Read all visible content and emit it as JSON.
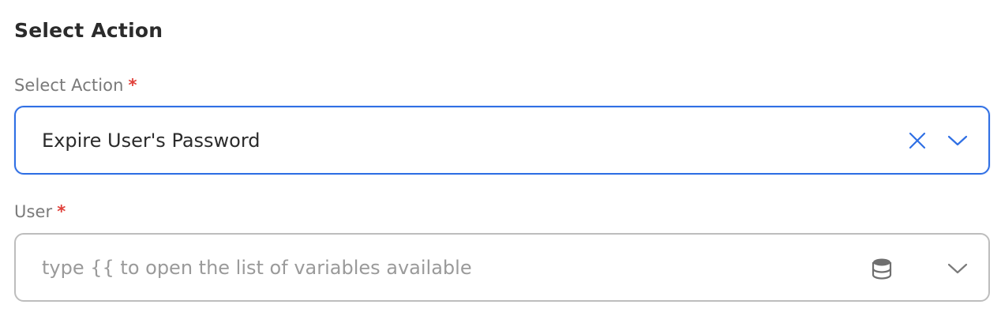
{
  "section": {
    "title": "Select Action"
  },
  "action_field": {
    "label": "Select Action",
    "required_marker": "*",
    "value": "Expire User's Password"
  },
  "user_field": {
    "label": "User",
    "required_marker": "*",
    "placeholder": "type {{ to open the list of variables available"
  },
  "icons": {
    "clear": "close-icon",
    "dropdown": "chevron-down-icon",
    "variables": "database-icon"
  },
  "colors": {
    "focus_border": "#2f6fe4",
    "required": "#e0403a",
    "default_border": "#bdbdbd"
  }
}
